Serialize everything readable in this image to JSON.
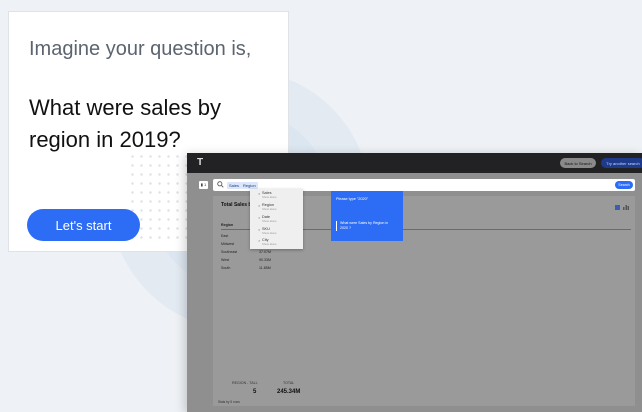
{
  "card": {
    "lead": "Imagine your question is,",
    "question": "What were sales by region in 2019?",
    "start_label": "Let's start"
  },
  "app": {
    "logo": "T",
    "back_label": "Back to Search",
    "try_label": "Try another search",
    "source_label": "▮ 1",
    "search": {
      "tokens": [
        "Sales",
        "Region"
      ],
      "go_label": "Search"
    },
    "panel_title": "Total Sales b",
    "table": {
      "header": "Region",
      "rows": [
        {
          "region": "East",
          "value": ""
        },
        {
          "region": "Midwest",
          "value": ""
        },
        {
          "region": "Southeast",
          "value": "37.07M"
        },
        {
          "region": "West",
          "value": "90.33M"
        },
        {
          "region": "South",
          "value": "11.85M"
        }
      ]
    },
    "kpis": [
      {
        "label": "REGION - TALL",
        "value": "5"
      },
      {
        "label": "TOTAL",
        "value": "245.34M"
      }
    ],
    "footnote": "Stats by 5 rows",
    "dropdown": [
      {
        "name": "Sales",
        "sub": "Show alone"
      },
      {
        "name": "Region",
        "sub": "Show alone"
      },
      {
        "name": "Date",
        "sub": "Show alone"
      },
      {
        "name": "SKU",
        "sub": "Show alone"
      },
      {
        "name": "City",
        "sub": "Show alone"
      }
    ],
    "tooltip": {
      "title": "Please type \"2020\"",
      "body": "What were Sales by Region in 2020 ?"
    }
  },
  "colors": {
    "accent": "#2d6df6",
    "topbar": "#222224",
    "overlay": "#8f8f8f"
  }
}
